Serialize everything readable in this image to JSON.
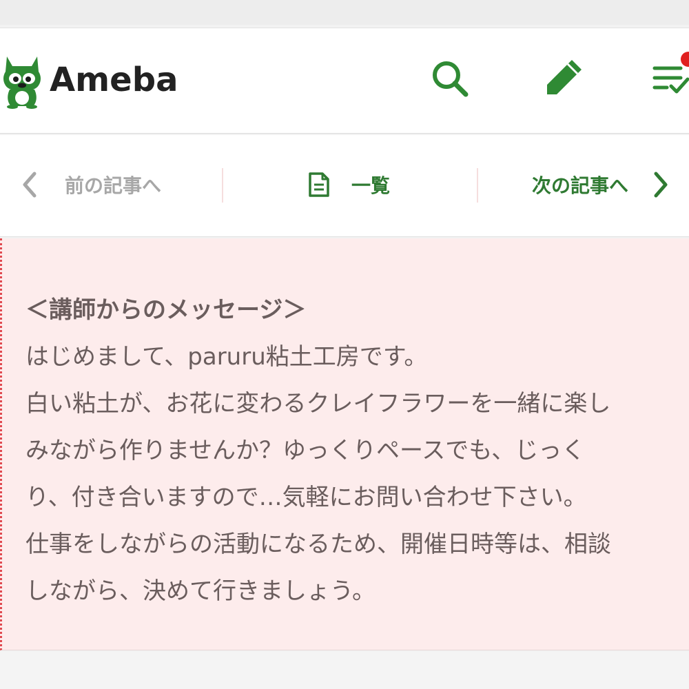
{
  "header": {
    "logo_text": "Ameba",
    "icons": [
      "search-icon",
      "pencil-icon",
      "checklist-icon"
    ],
    "notification": true
  },
  "nav": {
    "prev_label": "前の記事へ",
    "list_label": "一覧",
    "next_label": "次の記事へ"
  },
  "message": {
    "heading": "＜講師からのメッセージ＞",
    "lines": [
      "はじめまして、paruru粘土工房です。",
      "白い粘土が、お花に変わるクレイフラワーを一緒に楽し",
      "みながら作りませんか？ゆっくりペースでも、じっく",
      "り、付き合いますので…気軽にお問い合わせ下さい。",
      "仕事をしながらの活動になるため、開催日時等は、相談",
      "しながら、決めて行きましょう。"
    ]
  },
  "colors": {
    "brand_green": "#2f7a32",
    "message_bg": "#fdecec",
    "message_border": "#e0494f",
    "text": "#6a5d5d",
    "notification": "#e02020"
  }
}
